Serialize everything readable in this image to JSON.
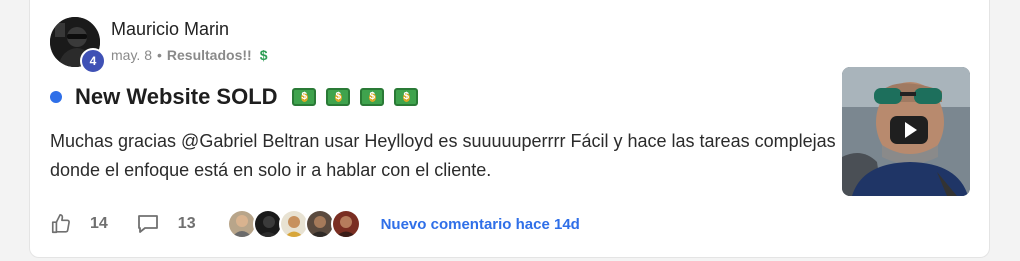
{
  "post": {
    "author": {
      "name": "Mauricio Marin",
      "level": "4"
    },
    "meta": {
      "date": "may. 8",
      "separator": "•",
      "category": "Resultados!!",
      "category_emoji": "$"
    },
    "title": "New Website SOLD",
    "title_emojis": [
      "money-bill-icon",
      "money-bill-icon",
      "money-bill-icon",
      "money-bill-icon"
    ],
    "body": "Muchas gracias @Gabriel Beltran usar Heylloyd es suuuuuperrrr Fácil y hace las tareas complejas donde el enfoque está en solo ir a hablar con el cliente.",
    "thumbnail": {
      "type": "video",
      "icon": "play-icon"
    },
    "likes": "14",
    "comments": "13",
    "new_comment_text": "Nuevo comentario hace 14d"
  },
  "colors": {
    "accent_blue": "#2f6fe8",
    "level_badge": "#3f51b5",
    "title_text": "#1e1e1e",
    "muted_text": "#8a8a8a"
  }
}
